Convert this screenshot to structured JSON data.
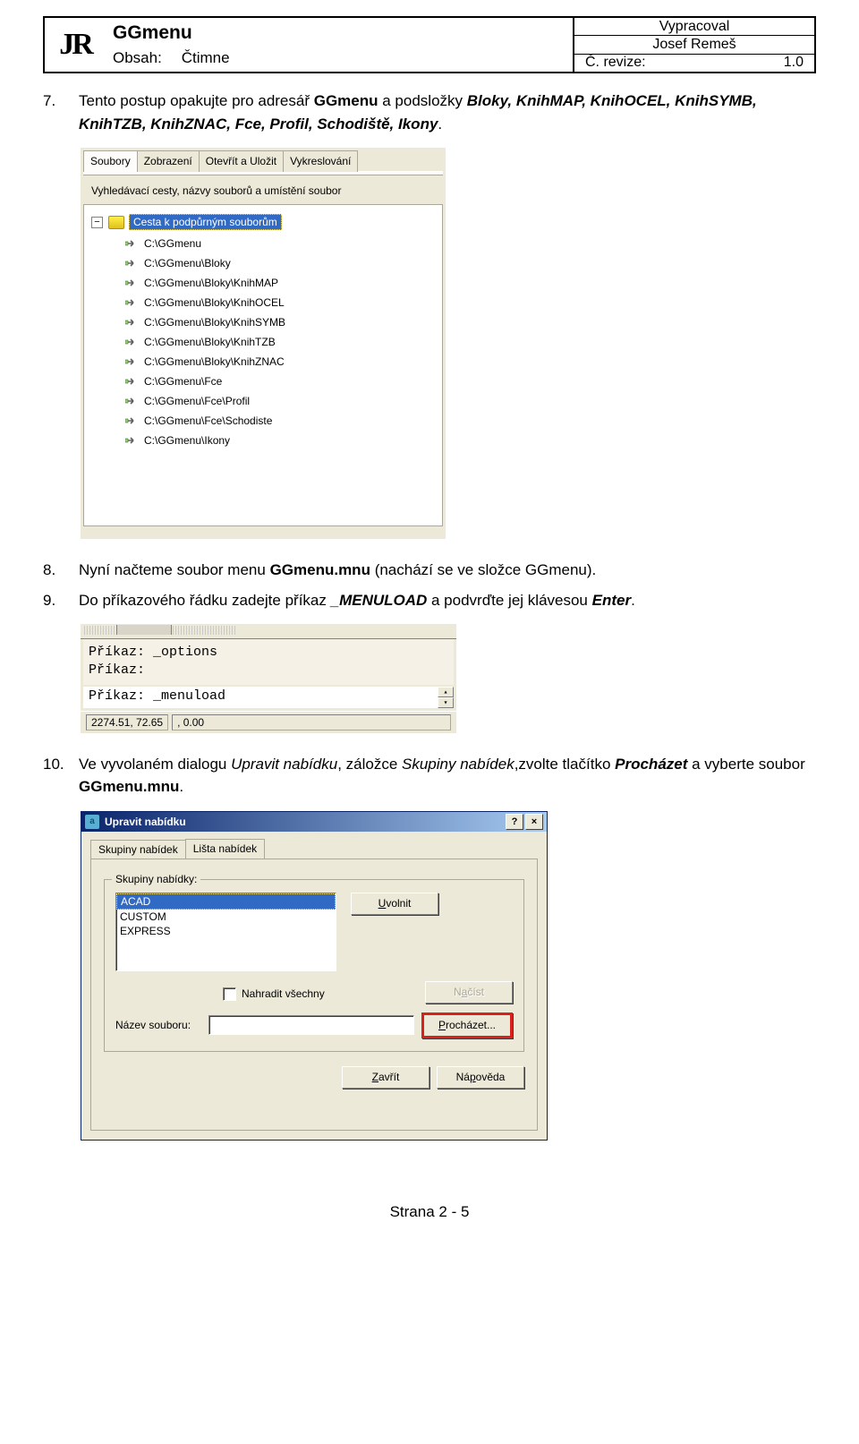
{
  "header": {
    "logo": "JR",
    "title": "GGmenu",
    "content_label": "Obsah:",
    "content_value": "Čtimne",
    "meta1": "Vypracoval",
    "meta2": "Josef Remeš",
    "rev_label": "Č. revize:",
    "rev_value": "1.0"
  },
  "steps": {
    "s7": {
      "num": "7.",
      "part1": "Tento postup opakujte pro adresář ",
      "b1": "GGmenu",
      "part2": " a podsložky ",
      "bi_list": "Bloky, KnihMAP, KnihOCEL, KnihSYMB, KnihTZB, KnihZNAC, Fce, Profil, Schodiště, Ikony",
      "part3": "."
    },
    "s8": {
      "num": "8.",
      "part1": "Nyní načteme soubor menu ",
      "b1": "GGmenu.mnu",
      "part2": " (nachází se ve složce GGmenu)."
    },
    "s9": {
      "num": "9.",
      "part1": "Do příkazového řádku zadejte příkaz ",
      "bi1": "_MENULOAD",
      "part2": " a podvrďte jej klávesou ",
      "bi2": "Enter",
      "part3": "."
    },
    "s10": {
      "num": "10.",
      "part1": "Ve vyvolaném dialogu ",
      "i1": "Upravit nabídku",
      "part2": ", záložce ",
      "i2": "Skupiny nabídek",
      "part3": ",zvolte tlačítko ",
      "bi1": "Procházet",
      "part4": " a vyberte soubor ",
      "b1": "GGmenu.mnu",
      "part5": "."
    }
  },
  "ss1": {
    "tabs": [
      "Soubory",
      "Zobrazení",
      "Otevřít a Uložit",
      "Vykreslování"
    ],
    "desc": "Vyhledávací cesty, názvy souborů a umístění soubor",
    "root": "Cesta k podpůrným souborům",
    "paths": [
      "C:\\GGmenu",
      "C:\\GGmenu\\Bloky",
      "C:\\GGmenu\\Bloky\\KnihMAP",
      "C:\\GGmenu\\Bloky\\KnihOCEL",
      "C:\\GGmenu\\Bloky\\KnihSYMB",
      "C:\\GGmenu\\Bloky\\KnihTZB",
      "C:\\GGmenu\\Bloky\\KnihZNAC",
      "C:\\GGmenu\\Fce",
      "C:\\GGmenu\\Fce\\Profil",
      "C:\\GGmenu\\Fce\\Schodiste",
      "C:\\GGmenu\\Ikony"
    ]
  },
  "ss2": {
    "line1": "Příkaz: _options",
    "line2": "Příkaz:",
    "input_label": "Příkaz:",
    "input_value": "_menuload",
    "status1": "2274.51, 72.65",
    "status2": ", 0.00"
  },
  "ss3": {
    "title": "Upravit nabídku",
    "help_btn": "?",
    "close_btn": "×",
    "tabs": [
      "Skupiny nabídek",
      "Lišta nabídek"
    ],
    "group_legend": "Skupiny nabídky:",
    "list_items": [
      "ACAD",
      "CUSTOM",
      "EXPRESS"
    ],
    "unload_u": "U",
    "unload_rest": "volnit",
    "replace_label_pre": "Na",
    "replace_label_u": "h",
    "replace_label_post": "radit všechny",
    "load_pre": "N",
    "load_u": "a",
    "load_post": "číst",
    "name_label_pre": "Náze",
    "name_label_u": "v",
    "name_label_post": " souboru:",
    "browse_u": "P",
    "browse_rest": "rocházet...",
    "close_pre": "",
    "close2_u": "Z",
    "close2_rest": "avřít",
    "help2_pre": "Ná",
    "help2_u": "p",
    "help2_post": "ověda"
  },
  "footer": "Strana 2 - 5"
}
